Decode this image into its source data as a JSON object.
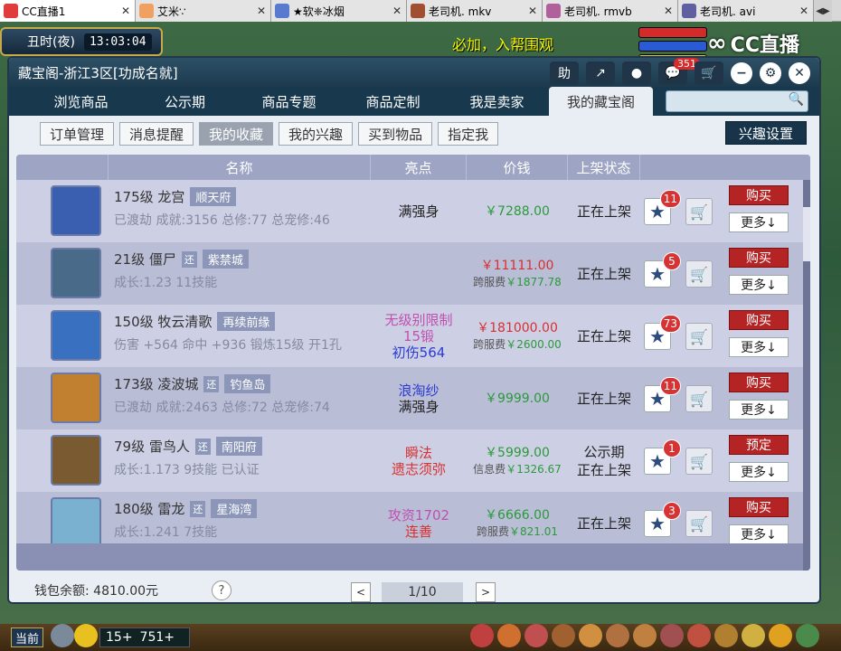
{
  "browser_tabs": [
    {
      "title": "CC直播1",
      "color": "#e23b3b",
      "active": true
    },
    {
      "title": "艾米∵",
      "color": "#f0a060",
      "active": false
    },
    {
      "title": "★软❈冰烟",
      "color": "#5a7ad0",
      "active": false
    },
    {
      "title": "老司机. mkv",
      "color": "#a05030",
      "active": false
    },
    {
      "title": "老司机. rmvb",
      "color": "#b0609a",
      "active": false
    },
    {
      "title": "老司机. avi",
      "color": "#6060a0",
      "active": false
    }
  ],
  "hud": {
    "period": "丑时(夜)",
    "time": "13:03:04",
    "banner": "必加，入帮围观",
    "logo_text": "CC直播"
  },
  "window": {
    "title": "藏宝阁-浙江3区[功成名就]",
    "help_label": "助",
    "message_count": "351",
    "nav_tabs": [
      "浏览商品",
      "公示期",
      "商品专题",
      "商品定制",
      "我是卖家",
      "我的藏宝阁"
    ],
    "active_nav": 5,
    "sub_tabs": [
      "订单管理",
      "消息提醒",
      "我的收藏",
      "我的兴趣",
      "买到物品",
      "指定我"
    ],
    "active_sub": 2,
    "interest_settings": "兴趣设置"
  },
  "table": {
    "headers": [
      "名称",
      "亮点",
      "价钱",
      "上架状态"
    ],
    "rows": [
      {
        "level_name": "175级  龙宫",
        "tag": "顺天府",
        "tag_small": "",
        "desc": "已渡劫 成就:3156 总修:77 总宠修:46",
        "highlight": [
          "满强身"
        ],
        "highlight_colors": [
          "#222"
        ],
        "price": "￥7288.00",
        "price_color": "#2a9a3a",
        "fee_label": "",
        "fee": "",
        "status": [
          "正在上架"
        ],
        "star_count": "11",
        "primary_action": "购买",
        "more": "更多↓",
        "avatar_color": "#3b5fb0"
      },
      {
        "level_name": "21级  僵尸",
        "tag": "紫禁城",
        "tag_small": "还",
        "desc": "成长:1.23 11技能",
        "highlight": [],
        "highlight_colors": [],
        "price": "￥11111.00",
        "price_color": "#d83030",
        "fee_label": "跨服费",
        "fee": "￥1877.78",
        "status": [
          "正在上架"
        ],
        "star_count": "5",
        "primary_action": "购买",
        "more": "更多↓",
        "avatar_color": "#4a6a8a"
      },
      {
        "level_name": "150级  牧云清歌",
        "tag": "再续前缘",
        "tag_small": "",
        "desc": "伤害 +564 命中 +936 锻炼15级 开1孔",
        "highlight": [
          "无级别限制",
          "15锻",
          "初伤564"
        ],
        "highlight_colors": [
          "#c050b0",
          "#c050b0",
          "#2a3ad0"
        ],
        "price": "￥181000.00",
        "price_color": "#d83030",
        "fee_label": "跨服费",
        "fee": "￥2600.00",
        "status": [
          "正在上架"
        ],
        "star_count": "73",
        "primary_action": "购买",
        "more": "更多↓",
        "avatar_color": "#3a70c0"
      },
      {
        "level_name": "173级  凌波城",
        "tag": "钓鱼岛",
        "tag_small": "还",
        "desc": "已渡劫 成就:2463 总修:72 总宠修:74",
        "highlight": [
          "浪淘纱",
          "满强身"
        ],
        "highlight_colors": [
          "#2a3ad0",
          "#222"
        ],
        "price": "￥9999.00",
        "price_color": "#2a9a3a",
        "fee_label": "",
        "fee": "",
        "status": [
          "正在上架"
        ],
        "star_count": "11",
        "primary_action": "购买",
        "more": "更多↓",
        "avatar_color": "#c08030"
      },
      {
        "level_name": "79级  雷鸟人",
        "tag": "南阳府",
        "tag_small": "还",
        "desc": "成长:1.173 9技能 已认证",
        "highlight": [
          "瞬法",
          "遗志须弥"
        ],
        "highlight_colors": [
          "#d83030",
          "#d83030"
        ],
        "price": "￥5999.00",
        "price_color": "#2a9a3a",
        "fee_label": "信息费",
        "fee": "￥1326.67",
        "status": [
          "公示期",
          "正在上架"
        ],
        "star_count": "1",
        "primary_action": "预定",
        "more": "更多↓",
        "avatar_color": "#7a5a30"
      },
      {
        "level_name": "180级  雷龙",
        "tag": "星海湾",
        "tag_small": "还",
        "desc": "成长:1.241 7技能",
        "highlight": [
          "攻资1702",
          "连善"
        ],
        "highlight_colors": [
          "#c050b0",
          "#d83030"
        ],
        "price": "￥6666.00",
        "price_color": "#2a9a3a",
        "fee_label": "跨服费",
        "fee": "￥821.01",
        "status": [
          "正在上架"
        ],
        "star_count": "3",
        "primary_action": "购买",
        "more": "更多↓",
        "avatar_color": "#7ab0d0"
      }
    ]
  },
  "footer": {
    "wallet": "钱包余额: 4810.00元",
    "help": "?",
    "page": "1/10",
    "prev": "<",
    "next": ">"
  },
  "bottom_hud": {
    "current_label": "当前",
    "level_a": "15+",
    "level_b": "751+"
  }
}
